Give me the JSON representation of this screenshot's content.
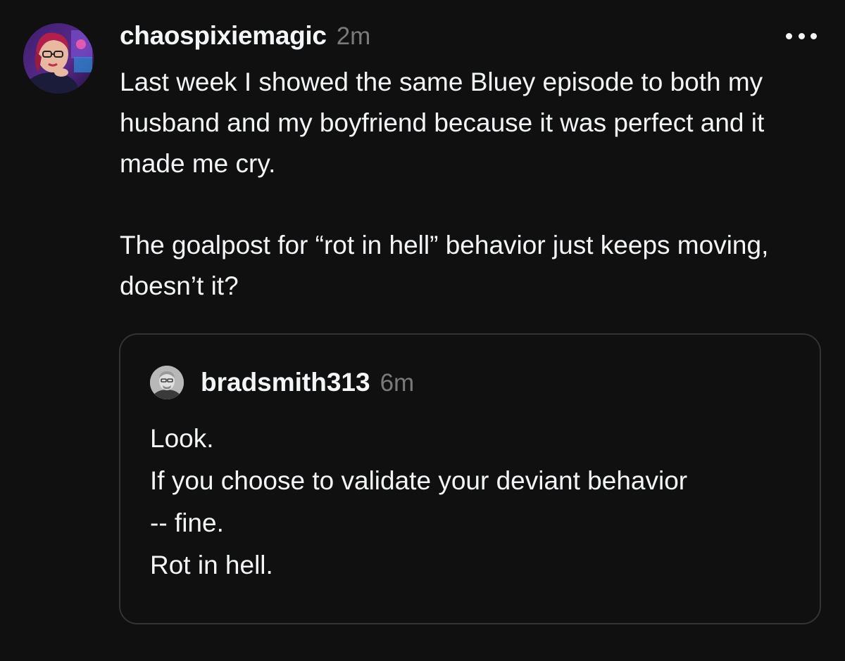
{
  "post": {
    "username": "chaospixiemagic",
    "timestamp": "2m",
    "avatar_icon": "user-avatar-photo",
    "more_icon": "more-options-icon",
    "paragraphs": [
      "Last week I showed the same Bluey episode to both my husband and my boyfriend because it was perfect and it made me cry.",
      "The goalpost for “rot in hell” behavior just keeps moving, doesn’t it?"
    ]
  },
  "quoted_post": {
    "username": "bradsmith313",
    "timestamp": "6m",
    "avatar_icon": "user-avatar-photo",
    "lines": [
      "Look.",
      "If you choose to validate your deviant behavior",
      "-- fine.",
      "Rot in hell."
    ]
  },
  "colors": {
    "background": "#101010",
    "text": "#f3f5f7",
    "secondary_text": "#7a7a7a",
    "card_border": "#333333"
  }
}
